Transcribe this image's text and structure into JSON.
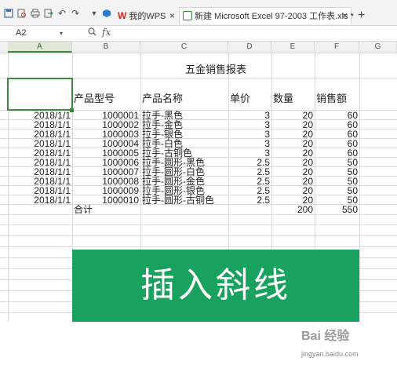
{
  "toolbar": {
    "icons": [
      "save-icon",
      "print-preview-icon",
      "print-icon",
      "export-icon",
      "undo-icon",
      "redo-icon",
      "dropdown-icon"
    ]
  },
  "tabs": {
    "wps_label": "我的WPS",
    "file_label": "新建 Microsoft Excel 97-2003 工作表.xls *"
  },
  "formula_bar": {
    "cell_ref": "A2",
    "fx": "fx"
  },
  "columns": [
    "A",
    "B",
    "C",
    "D",
    "E",
    "F",
    "G"
  ],
  "sheet": {
    "title": "五金销售报表",
    "headers": {
      "model": "产品型号",
      "name": "产品名称",
      "price": "单价",
      "qty": "数量",
      "amount": "销售额"
    },
    "rows": [
      {
        "date": "2018/1/1",
        "model": "1000001",
        "name": "拉手-黑色",
        "price": "3",
        "qty": "20",
        "amount": "60"
      },
      {
        "date": "2018/1/1",
        "model": "1000002",
        "name": "拉手-金色",
        "price": "3",
        "qty": "20",
        "amount": "60"
      },
      {
        "date": "2018/1/1",
        "model": "1000003",
        "name": "拉手-银色",
        "price": "3",
        "qty": "20",
        "amount": "60"
      },
      {
        "date": "2018/1/1",
        "model": "1000004",
        "name": "拉手-白色",
        "price": "3",
        "qty": "20",
        "amount": "60"
      },
      {
        "date": "2018/1/1",
        "model": "1000005",
        "name": "拉手-古铜色",
        "price": "3",
        "qty": "20",
        "amount": "60"
      },
      {
        "date": "2018/1/1",
        "model": "1000006",
        "name": "拉手-圆形-黑色",
        "price": "2.5",
        "qty": "20",
        "amount": "50"
      },
      {
        "date": "2018/1/1",
        "model": "1000007",
        "name": "拉手-圆形-白色",
        "price": "2.5",
        "qty": "20",
        "amount": "50"
      },
      {
        "date": "2018/1/1",
        "model": "1000008",
        "name": "拉手-圆形-金色",
        "price": "2.5",
        "qty": "20",
        "amount": "50"
      },
      {
        "date": "2018/1/1",
        "model": "1000009",
        "name": "拉手-圆形-银色",
        "price": "2.5",
        "qty": "20",
        "amount": "50"
      },
      {
        "date": "2018/1/1",
        "model": "1000010",
        "name": "拉手-圆形-古铜色",
        "price": "2.5",
        "qty": "20",
        "amount": "50"
      }
    ],
    "total": {
      "label": "合计",
      "qty": "200",
      "amount": "550"
    }
  },
  "banner": {
    "text": "插入斜线",
    "color": "#19a15f"
  },
  "watermark": {
    "brand": "Bai 经验",
    "url": "jingyan.baidu.com"
  },
  "colors": {
    "selection": "#3a8a3a",
    "grid": "#dadada"
  }
}
